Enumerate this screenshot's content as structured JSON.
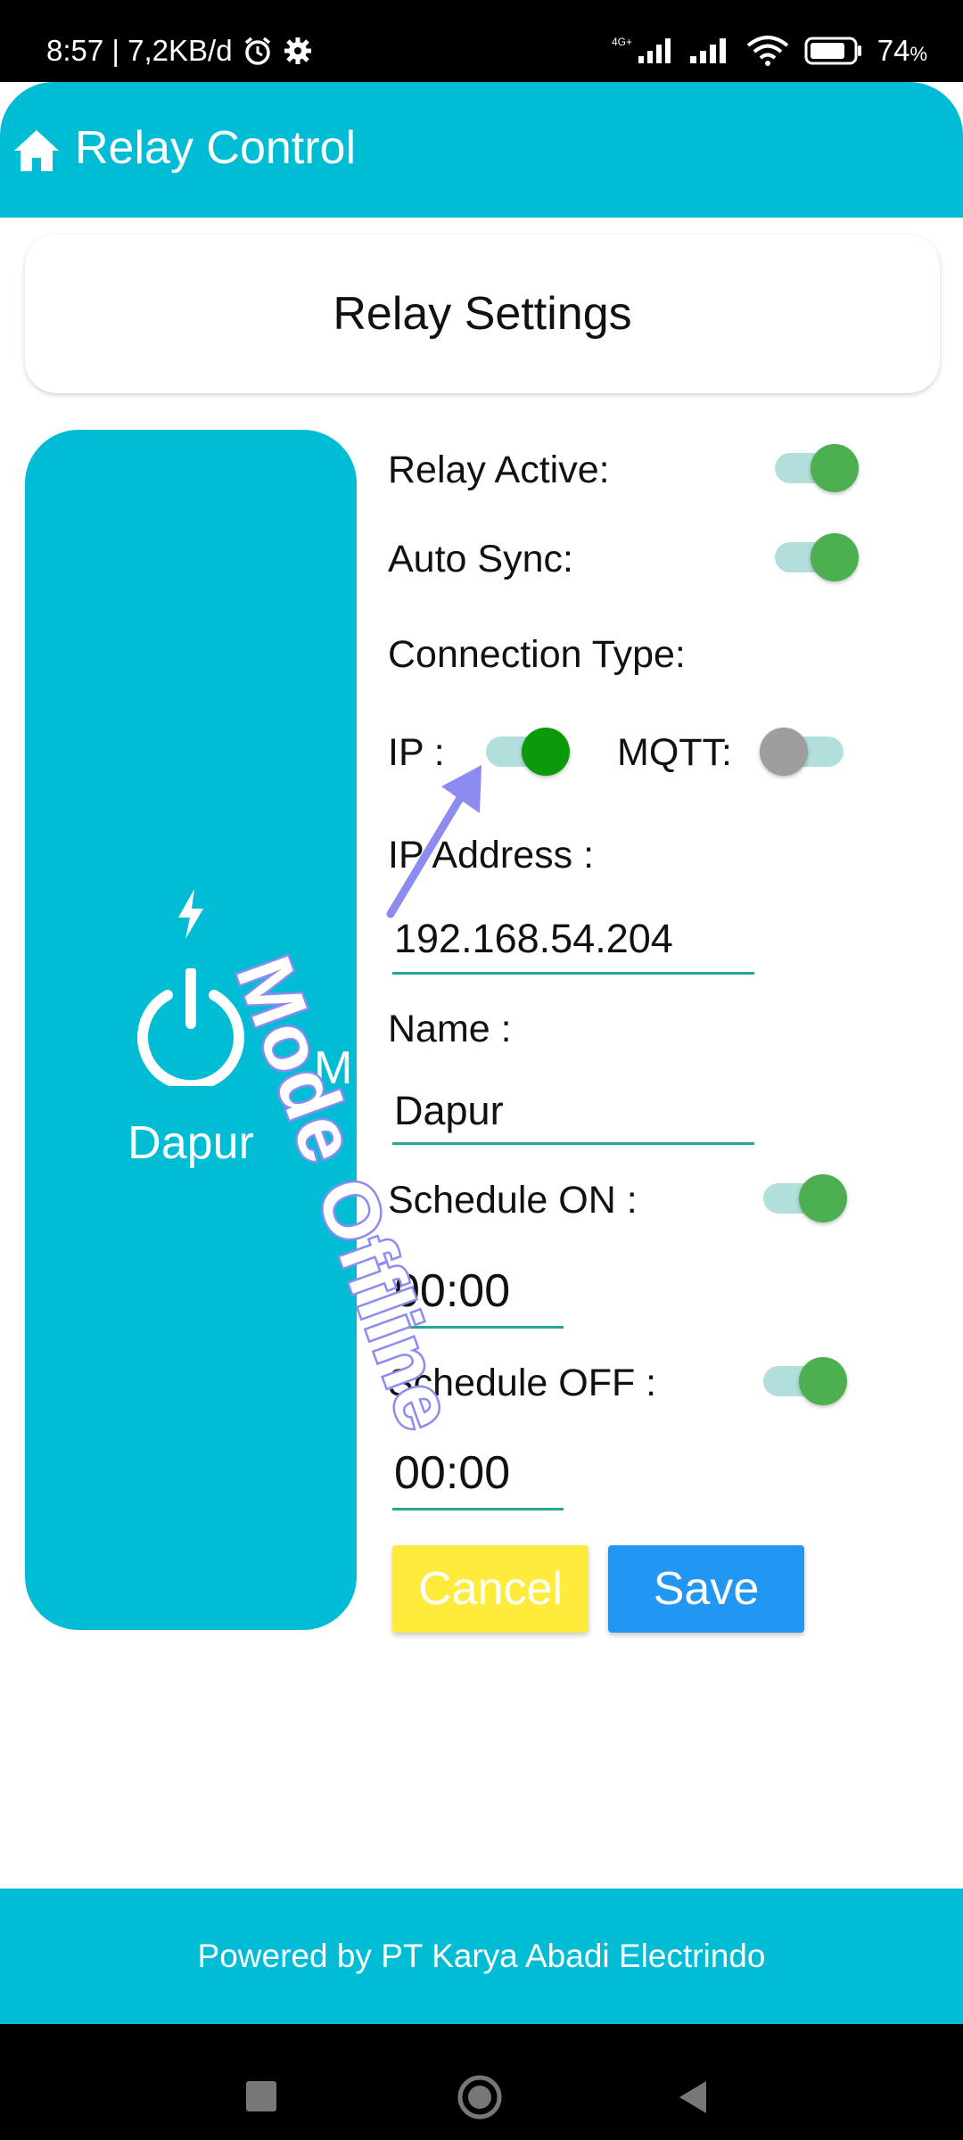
{
  "status_bar": {
    "time_speed": "8:57 | 7,2KB/d",
    "network": "4G+",
    "battery": "74",
    "battery_unit": "%"
  },
  "app_bar": {
    "title": "Relay Control",
    "icon": "home-icon"
  },
  "card": {
    "title": "Relay Settings"
  },
  "relay": {
    "name": "Dapur",
    "icons": [
      "bolt-icon",
      "power-icon"
    ]
  },
  "form": {
    "relay_active_label": "Relay Active:",
    "relay_active": true,
    "auto_sync_label": "Auto Sync:",
    "auto_sync": true,
    "connection_type_label": "Connection Type:",
    "ip_label": "IP :",
    "ip_enabled": true,
    "mqtt_label": "MQTT:",
    "mqtt_enabled": false,
    "ip_address_label": "IP Address :",
    "ip_address_value": "192.168.54.204",
    "name_label": "Name :",
    "name_value": "Dapur",
    "schedule_on_label": "Schedule ON :",
    "schedule_on_enabled": true,
    "schedule_on_time": "00:00",
    "schedule_off_label": "Schedule OFF :",
    "schedule_off_enabled": true,
    "schedule_off_time": "00:00"
  },
  "buttons": {
    "cancel": "Cancel",
    "save": "Save"
  },
  "annotation": {
    "text": "Mode Offline",
    "ghost": "M"
  },
  "footer": {
    "text": "Powered by PT Karya Abadi Electrindo"
  },
  "colors": {
    "primary": "#00bcd4",
    "switch_on": "#4caf50",
    "switch_off": "#9e9e9e",
    "underline": "#26a69a",
    "cancel": "#ffeb3b",
    "save": "#2196f3",
    "annotation": "#8c8cf0"
  }
}
